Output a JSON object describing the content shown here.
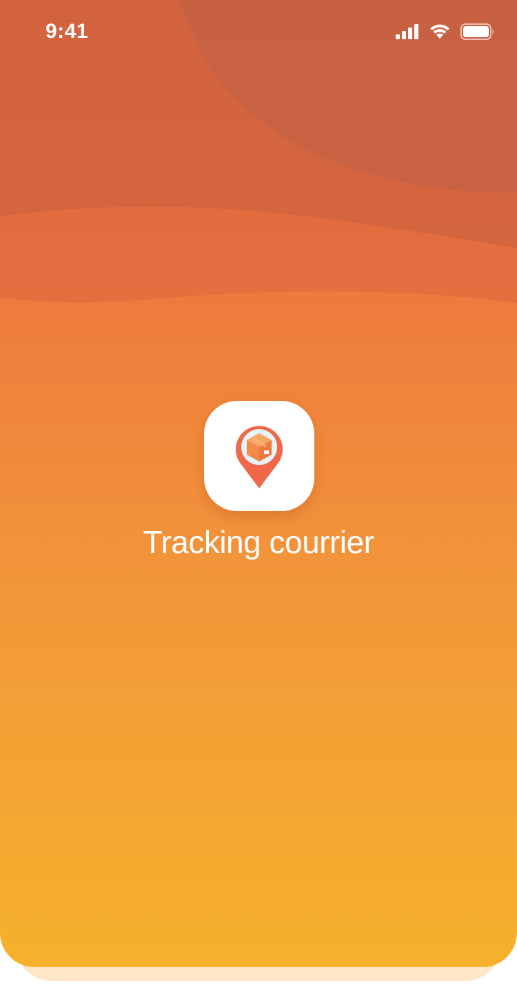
{
  "status_bar": {
    "time": "9:41",
    "signal_icon": "cellular-signal-icon",
    "wifi_icon": "wifi-icon",
    "battery_icon": "battery-icon"
  },
  "app": {
    "title": "Tracking courrier",
    "logo_icon": "location-pin-package-icon"
  },
  "colors": {
    "gradient_top": "#ea6a3d",
    "gradient_bottom": "#f6b12c",
    "pin": "#f0674a",
    "package": "#f4894a",
    "shadow_card": "#fde7c7"
  }
}
